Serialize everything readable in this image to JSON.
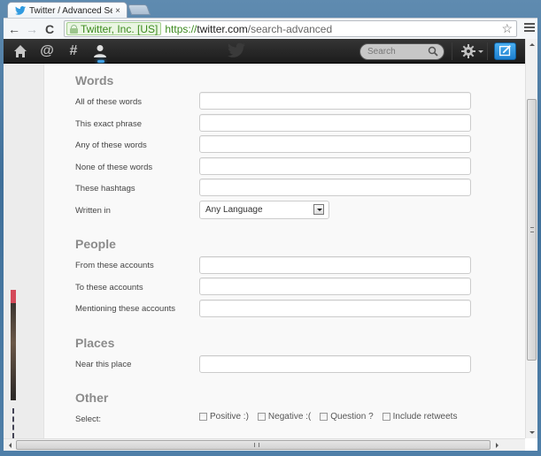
{
  "browser": {
    "tab_title": "Twitter / Advanced Search",
    "close_glyph": "×",
    "back_glyph": "←",
    "forward_glyph": "→",
    "reload_glyph": "C",
    "ev_org": "Twitter, Inc. [US]",
    "url_scheme": "https://",
    "url_host": "twitter.com",
    "url_path": "/search-advanced",
    "bookmark_glyph": "☆"
  },
  "twitter_nav": {
    "home_glyph": "⌂",
    "connect_glyph": "@",
    "discover_glyph": "#",
    "me_glyph": "👤",
    "search_placeholder": "Search",
    "accent_color": "#3fa0e6"
  },
  "form": {
    "sections": {
      "words": {
        "title": "Words",
        "fields": [
          {
            "label": "All of these words",
            "value": ""
          },
          {
            "label": "This exact phrase",
            "value": ""
          },
          {
            "label": "Any of these words",
            "value": ""
          },
          {
            "label": "None of these words",
            "value": ""
          },
          {
            "label": "These hashtags",
            "value": ""
          }
        ],
        "language_label": "Written in",
        "language_value": "Any Language"
      },
      "people": {
        "title": "People",
        "fields": [
          {
            "label": "From these accounts",
            "value": ""
          },
          {
            "label": "To these accounts",
            "value": ""
          },
          {
            "label": "Mentioning these accounts",
            "value": ""
          }
        ]
      },
      "places": {
        "title": "Places",
        "fields": [
          {
            "label": "Near this place",
            "value": ""
          }
        ]
      },
      "other": {
        "title": "Other",
        "select_label": "Select:",
        "options": [
          {
            "label": "Positive :)",
            "checked": false
          },
          {
            "label": "Negative :(",
            "checked": false
          },
          {
            "label": "Question ?",
            "checked": false
          },
          {
            "label": "Include retweets",
            "checked": false
          }
        ]
      }
    }
  }
}
